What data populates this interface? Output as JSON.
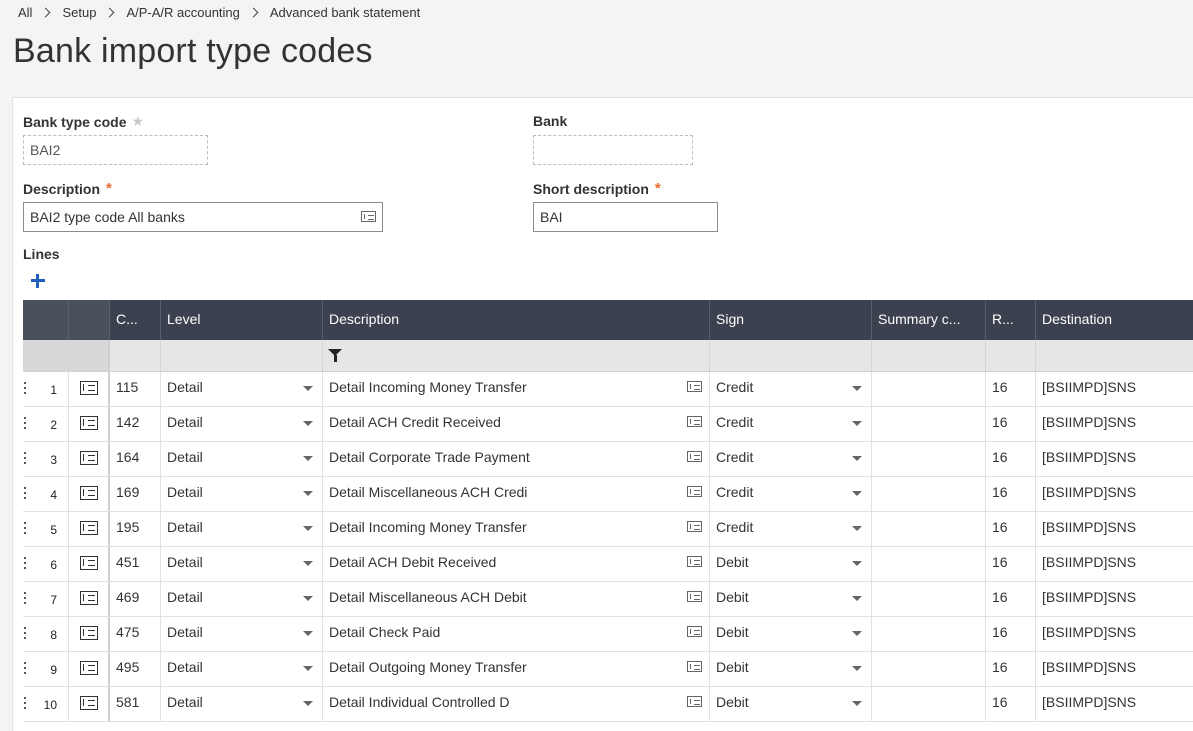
{
  "breadcrumb": [
    "All",
    "Setup",
    "A/P-A/R accounting",
    "Advanced bank statement"
  ],
  "page_title": "Bank import type codes",
  "form": {
    "bank_type_code": {
      "label": "Bank type code",
      "value": "BAI2",
      "required_indicator": "★"
    },
    "bank": {
      "label": "Bank",
      "value": ""
    },
    "description": {
      "label": "Description",
      "value": "BAI2 type code All banks",
      "required_indicator": "*"
    },
    "short_description": {
      "label": "Short description",
      "value": "BAI",
      "required_indicator": "*"
    }
  },
  "lines": {
    "title": "Lines",
    "columns": [
      "C...",
      "Level",
      "Description",
      "Sign",
      "Summary c...",
      "R...",
      "Destination"
    ],
    "rows": [
      {
        "num": "1",
        "code": "115",
        "level": "Detail",
        "description": "Detail Incoming Money Transfer",
        "sign": "Credit",
        "summary": "",
        "r": "16",
        "destination": "[BSIIMPD]SNS"
      },
      {
        "num": "2",
        "code": "142",
        "level": "Detail",
        "description": "Detail ACH Credit Received",
        "sign": "Credit",
        "summary": "",
        "r": "16",
        "destination": "[BSIIMPD]SNS"
      },
      {
        "num": "3",
        "code": "164",
        "level": "Detail",
        "description": "Detail Corporate Trade Payment",
        "sign": "Credit",
        "summary": "",
        "r": "16",
        "destination": "[BSIIMPD]SNS"
      },
      {
        "num": "4",
        "code": "169",
        "level": "Detail",
        "description": "Detail Miscellaneous ACH Credi",
        "sign": "Credit",
        "summary": "",
        "r": "16",
        "destination": "[BSIIMPD]SNS"
      },
      {
        "num": "5",
        "code": "195",
        "level": "Detail",
        "description": "Detail Incoming Money Transfer",
        "sign": "Credit",
        "summary": "",
        "r": "16",
        "destination": "[BSIIMPD]SNS"
      },
      {
        "num": "6",
        "code": "451",
        "level": "Detail",
        "description": "Detail ACH Debit Received",
        "sign": "Debit",
        "summary": "",
        "r": "16",
        "destination": "[BSIIMPD]SNS"
      },
      {
        "num": "7",
        "code": "469",
        "level": "Detail",
        "description": "Detail Miscellaneous ACH Debit",
        "sign": "Debit",
        "summary": "",
        "r": "16",
        "destination": "[BSIIMPD]SNS"
      },
      {
        "num": "8",
        "code": "475",
        "level": "Detail",
        "description": "Detail Check Paid",
        "sign": "Debit",
        "summary": "",
        "r": "16",
        "destination": "[BSIIMPD]SNS"
      },
      {
        "num": "9",
        "code": "495",
        "level": "Detail",
        "description": "Detail Outgoing Money Transfer",
        "sign": "Debit",
        "summary": "",
        "r": "16",
        "destination": "[BSIIMPD]SNS"
      },
      {
        "num": "10",
        "code": "581",
        "level": "Detail",
        "description": "Detail Individual Controlled D",
        "sign": "Debit",
        "summary": "",
        "r": "16",
        "destination": "[BSIIMPD]SNS"
      }
    ]
  },
  "icons": {
    "breadcrumb_separator": "chevron-right-icon",
    "add": "plus-icon",
    "filter": "filter-icon",
    "row_detail": "detail-panel-icon",
    "zoom": "zoom-selection-icon",
    "dropdown": "caret-down-icon"
  },
  "colors": {
    "grid_header": "#3c4150",
    "accent_blue": "#1f5fbf",
    "required_star": "#e8672f"
  }
}
